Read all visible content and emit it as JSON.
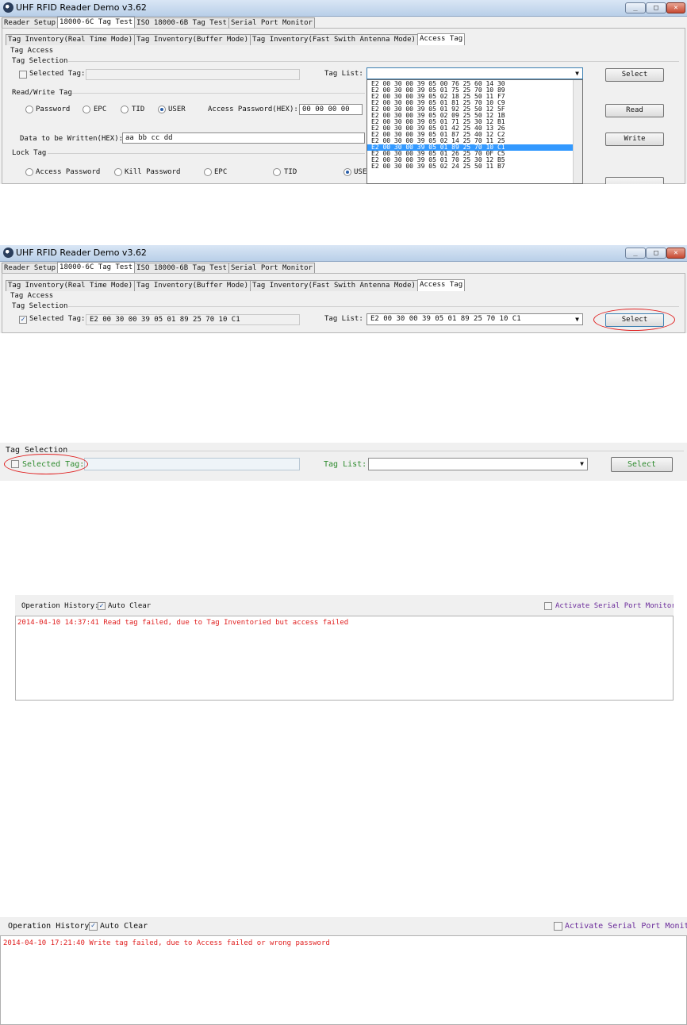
{
  "shot1": {
    "app_title": "UHF RFID Reader Demo v3.62",
    "top_tabs": [
      "Reader Setup",
      "18000-6C Tag Test",
      "ISO 18000-6B Tag Test",
      "Serial Port Monitor"
    ],
    "sub_tabs": [
      "Tag Inventory(Real Time Mode)",
      "Tag Inventory(Buffer Mode)",
      "Tag Inventory(Fast Swith Antenna Mode)",
      "Access Tag"
    ],
    "tag_access_label": "Tag Access",
    "tag_selection_label": "Tag Selection",
    "selected_tag_label": "Selected Tag:",
    "selected_tag_value": "",
    "tag_list_label": "Tag List:",
    "tag_list_value": "",
    "select_button": "Select",
    "rw_group_label": "Read/Write Tag",
    "radios": [
      "Password",
      "EPC",
      "TID",
      "USER"
    ],
    "selected_radio": "USER",
    "access_password_label": "Access Password(HEX):",
    "access_password_value": "00 00 00 00",
    "read_button": "Read",
    "data_label": "Data to be Written(HEX):",
    "data_value": "aa bb cc dd",
    "write_button": "Write",
    "lock_group_label": "Lock Tag",
    "lock_radios": [
      "Access Password",
      "Kill Password",
      "EPC",
      "TID",
      "USE"
    ],
    "dropdown_items": [
      "E2 00 30 00 39 05 00 76 25 60 14 30",
      "E2 00 30 00 39 05 01 75 25 70 10 89",
      "E2 00 30 00 39 05 02 18 25 50 11 F7",
      "E2 00 30 00 39 05 01 81 25 70 10 C9",
      "E2 00 30 00 39 05 01 92 25 50 12 5F",
      "E2 00 30 00 39 05 02 09 25 50 12 1B",
      "E2 00 30 00 39 05 01 71 25 30 12 B1",
      "E2 00 30 00 39 05 01 42 25 40 13 26",
      "E2 00 30 00 39 05 01 87 25 40 12 C2",
      "E2 00 30 00 39 05 02 14 25 70 11 25",
      "E2 00 30 00 39 05 01 89 25 70 10 C1",
      "E2 00 30 00 39 05 01 26 25 70 0F C5",
      "E2 00 30 00 39 05 01 70 25 30 12 B5",
      "E2 00 30 00 39 05 02 24 25 50 11 B7"
    ],
    "dropdown_selected_index": 10
  },
  "shot2": {
    "app_title": "UHF RFID Reader Demo v3.62",
    "top_tabs": [
      "Reader Setup",
      "18000-6C Tag Test",
      "ISO 18000-6B Tag Test",
      "Serial Port Monitor"
    ],
    "sub_tabs": [
      "Tag Inventory(Real Time Mode)",
      "Tag Inventory(Buffer Mode)",
      "Tag Inventory(Fast Swith Antenna Mode)",
      "Access Tag"
    ],
    "tag_access_label": "Tag Access",
    "tag_selection_label": "Tag Selection",
    "selected_tag_label": "Selected Tag:",
    "selected_tag_value": "E2 00 30 00 39 05 01 89 25 70 10 C1",
    "tag_list_label": "Tag List:",
    "tag_list_value": "E2 00 30 00 39 05 01 89 25 70 10 C1",
    "select_button": "Select"
  },
  "shot3": {
    "tag_selection_label": "Tag Selection",
    "selected_tag_label": "Selected Tag:",
    "tag_list_label": "Tag List:",
    "select_button": "Select"
  },
  "shot4": {
    "history_label": "Operation History:",
    "auto_clear_label": "Auto Clear",
    "serial_monitor_label": "Activate Serial Port Monitor",
    "log": "2014-04-10 14:37:41 Read tag failed, due to Tag Inventoried but access failed"
  },
  "shot5": {
    "history_label": "Operation History:",
    "auto_clear_label": "Auto Clear",
    "serial_monitor_label": "Activate Serial Port Monitor",
    "log": "2014-04-10 17:21:40 Write tag failed, due to Access failed or wrong password"
  },
  "colors": {
    "highlight_red": "#e02020",
    "selection_blue": "#3399ff",
    "label_green": "#2e8b2e",
    "link_purple": "#6a2a9a"
  }
}
